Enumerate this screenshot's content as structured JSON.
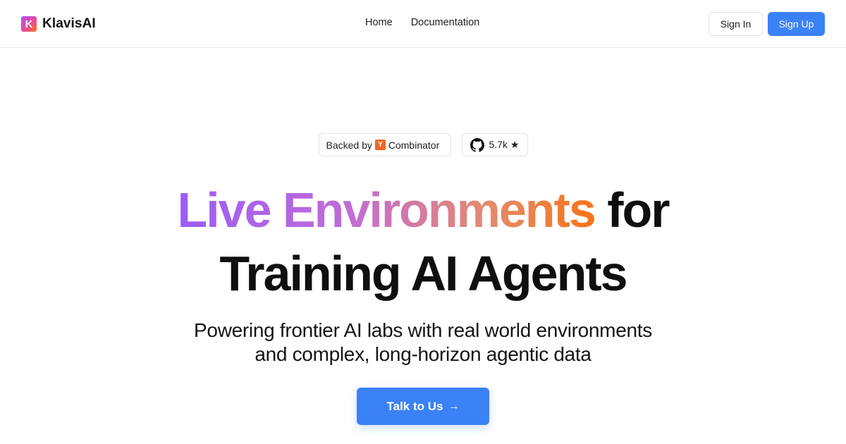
{
  "header": {
    "logo_letter": "K",
    "brand_name": "KlavisAI",
    "nav": [
      {
        "label": "Home"
      },
      {
        "label": "Documentation"
      }
    ],
    "sign_in_label": "Sign In",
    "sign_up_label": "Sign Up"
  },
  "badges": {
    "backed_by_label": "Backed by",
    "yc_letter": "Y",
    "combinator_label": "Combinator",
    "github_stars": "5.7k ★",
    "github_icon": "github-icon"
  },
  "hero": {
    "headline_gradient": "Live Environments",
    "headline_rest": " for",
    "headline_line2": "Training AI Agents",
    "subtitle_line1": "Powering frontier AI labs with real world environments",
    "subtitle_line2": "and complex, long-horizon agentic data",
    "cta_label": "Talk to Us",
    "cta_arrow": "→"
  },
  "colors": {
    "accent": "#3b82f6",
    "gradient_start": "#9b5cf6",
    "gradient_end": "#f97316",
    "yc_orange": "#f26522"
  }
}
